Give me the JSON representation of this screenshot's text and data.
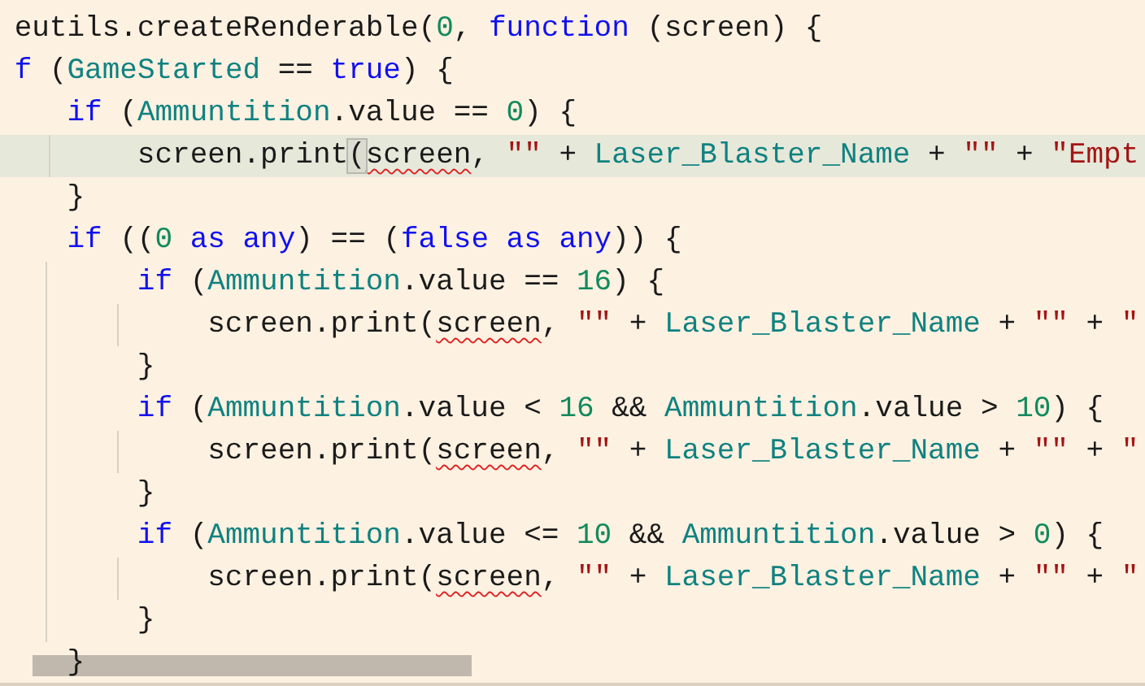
{
  "editor": {
    "lines": [
      {
        "current": false,
        "tokens": [
          {
            "text": "eutils.createRenderable(",
            "kind": "plain"
          },
          {
            "text": "0",
            "kind": "number"
          },
          {
            "text": ", ",
            "kind": "plain"
          },
          {
            "text": "function",
            "kind": "keyword"
          },
          {
            "text": " (screen) {",
            "kind": "plain"
          }
        ]
      },
      {
        "current": false,
        "tokens": [
          {
            "text": "f",
            "kind": "keyword"
          },
          {
            "text": " (",
            "kind": "plain"
          },
          {
            "text": "GameStarted",
            "kind": "identifier"
          },
          {
            "text": " == ",
            "kind": "plain"
          },
          {
            "text": "true",
            "kind": "keyword"
          },
          {
            "text": ") {",
            "kind": "plain"
          }
        ]
      },
      {
        "current": false,
        "tokens": [
          {
            "text": "   if",
            "kind": "keyword"
          },
          {
            "text": " (",
            "kind": "plain"
          },
          {
            "text": "Ammuntition",
            "kind": "identifier"
          },
          {
            "text": ".value == ",
            "kind": "plain"
          },
          {
            "text": "0",
            "kind": "number"
          },
          {
            "text": ") {",
            "kind": "plain"
          }
        ]
      },
      {
        "current": true,
        "tokens": [
          {
            "text": "       screen.print",
            "kind": "plain"
          },
          {
            "text": "(",
            "kind": "matched-bracket"
          },
          {
            "text": "screen",
            "kind": "error"
          },
          {
            "text": ", ",
            "kind": "plain"
          },
          {
            "text": "\"\"",
            "kind": "string"
          },
          {
            "text": " + ",
            "kind": "plain"
          },
          {
            "text": "Laser_Blaster_Name",
            "kind": "identifier"
          },
          {
            "text": " + ",
            "kind": "plain"
          },
          {
            "text": "\"\"",
            "kind": "string"
          },
          {
            "text": " + ",
            "kind": "plain"
          },
          {
            "text": "\"Empt",
            "kind": "string"
          }
        ]
      },
      {
        "current": false,
        "tokens": [
          {
            "text": "   }",
            "kind": "plain"
          }
        ]
      },
      {
        "current": false,
        "tokens": [
          {
            "text": "   if",
            "kind": "keyword"
          },
          {
            "text": " ((",
            "kind": "plain"
          },
          {
            "text": "0",
            "kind": "number"
          },
          {
            "text": " as any",
            "kind": "keyword"
          },
          {
            "text": ") == (",
            "kind": "plain"
          },
          {
            "text": "false as any",
            "kind": "keyword"
          },
          {
            "text": ")) {",
            "kind": "plain"
          }
        ]
      },
      {
        "current": false,
        "tokens": [
          {
            "text": "       if",
            "kind": "keyword"
          },
          {
            "text": " (",
            "kind": "plain"
          },
          {
            "text": "Ammuntition",
            "kind": "identifier"
          },
          {
            "text": ".value == ",
            "kind": "plain"
          },
          {
            "text": "16",
            "kind": "number"
          },
          {
            "text": ") {",
            "kind": "plain"
          }
        ]
      },
      {
        "current": false,
        "tokens": [
          {
            "text": "           screen.print(",
            "kind": "plain"
          },
          {
            "text": "screen",
            "kind": "error"
          },
          {
            "text": ", ",
            "kind": "plain"
          },
          {
            "text": "\"\"",
            "kind": "string"
          },
          {
            "text": " + ",
            "kind": "plain"
          },
          {
            "text": "Laser_Blaster_Name",
            "kind": "identifier"
          },
          {
            "text": " + ",
            "kind": "plain"
          },
          {
            "text": "\"\"",
            "kind": "string"
          },
          {
            "text": " + ",
            "kind": "plain"
          },
          {
            "text": "\"",
            "kind": "string"
          }
        ]
      },
      {
        "current": false,
        "tokens": [
          {
            "text": "       }",
            "kind": "plain"
          }
        ]
      },
      {
        "current": false,
        "tokens": [
          {
            "text": "       if",
            "kind": "keyword"
          },
          {
            "text": " (",
            "kind": "plain"
          },
          {
            "text": "Ammuntition",
            "kind": "identifier"
          },
          {
            "text": ".value < ",
            "kind": "plain"
          },
          {
            "text": "16",
            "kind": "number"
          },
          {
            "text": " && ",
            "kind": "plain"
          },
          {
            "text": "Ammuntition",
            "kind": "identifier"
          },
          {
            "text": ".value > ",
            "kind": "plain"
          },
          {
            "text": "10",
            "kind": "number"
          },
          {
            "text": ") {",
            "kind": "plain"
          }
        ]
      },
      {
        "current": false,
        "tokens": [
          {
            "text": "           screen.print(",
            "kind": "plain"
          },
          {
            "text": "screen",
            "kind": "error"
          },
          {
            "text": ", ",
            "kind": "plain"
          },
          {
            "text": "\"\"",
            "kind": "string"
          },
          {
            "text": " + ",
            "kind": "plain"
          },
          {
            "text": "Laser_Blaster_Name",
            "kind": "identifier"
          },
          {
            "text": " + ",
            "kind": "plain"
          },
          {
            "text": "\"\"",
            "kind": "string"
          },
          {
            "text": " + ",
            "kind": "plain"
          },
          {
            "text": "\"",
            "kind": "string"
          }
        ]
      },
      {
        "current": false,
        "tokens": [
          {
            "text": "       }",
            "kind": "plain"
          }
        ]
      },
      {
        "current": false,
        "tokens": [
          {
            "text": "       if",
            "kind": "keyword"
          },
          {
            "text": " (",
            "kind": "plain"
          },
          {
            "text": "Ammuntition",
            "kind": "identifier"
          },
          {
            "text": ".value <= ",
            "kind": "plain"
          },
          {
            "text": "10",
            "kind": "number"
          },
          {
            "text": " && ",
            "kind": "plain"
          },
          {
            "text": "Ammuntition",
            "kind": "identifier"
          },
          {
            "text": ".value > ",
            "kind": "plain"
          },
          {
            "text": "0",
            "kind": "number"
          },
          {
            "text": ") {",
            "kind": "plain"
          }
        ]
      },
      {
        "current": false,
        "tokens": [
          {
            "text": "           screen.print(",
            "kind": "plain"
          },
          {
            "text": "screen",
            "kind": "error"
          },
          {
            "text": ", ",
            "kind": "plain"
          },
          {
            "text": "\"\"",
            "kind": "string"
          },
          {
            "text": " + ",
            "kind": "plain"
          },
          {
            "text": "Laser_Blaster_Name",
            "kind": "identifier"
          },
          {
            "text": " + ",
            "kind": "plain"
          },
          {
            "text": "\"\"",
            "kind": "string"
          },
          {
            "text": " + ",
            "kind": "plain"
          },
          {
            "text": "\"",
            "kind": "string"
          }
        ]
      },
      {
        "current": false,
        "tokens": [
          {
            "text": "       }",
            "kind": "plain"
          }
        ]
      },
      {
        "current": false,
        "tokens": [
          {
            "text": "   }",
            "kind": "plain"
          }
        ]
      }
    ]
  }
}
